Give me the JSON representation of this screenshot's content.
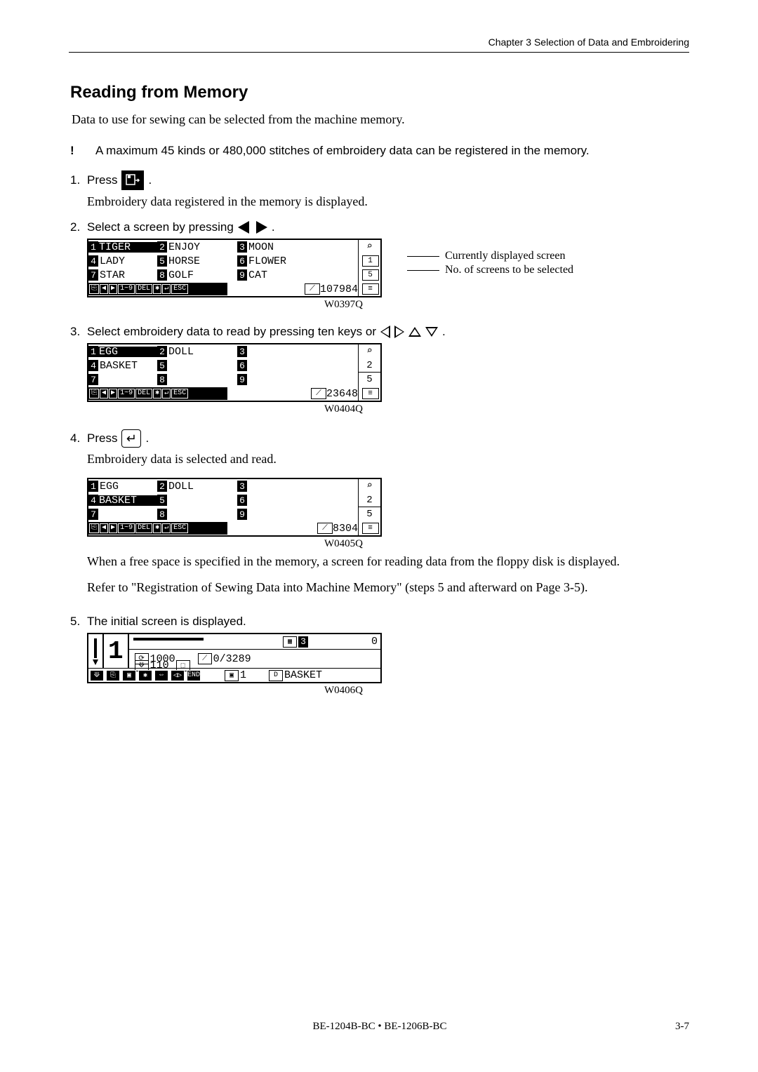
{
  "header": {
    "chapter": "Chapter 3   Selection of Data and Embroidering"
  },
  "section": {
    "title": "Reading from Memory",
    "intro": "Data to use for sewing can be selected from the machine memory.",
    "note_mark": "!",
    "note": "A maximum 45 kinds or 480,000 stitches of embroidery data can be registered in the memory."
  },
  "steps": {
    "s1": {
      "num": "1.",
      "label": "Press",
      "after": ".",
      "sub": "Embroidery data registered in the memory is displayed."
    },
    "s2": {
      "num": "2.",
      "label": "Select a screen by pressing",
      "after": ".",
      "lcd": {
        "r1": [
          "1",
          "TIGER",
          "2",
          "ENJOY",
          "3",
          "MOON"
        ],
        "r2": [
          "4",
          "LADY",
          "5",
          "HORSE",
          "6",
          "FLOWER"
        ],
        "r3": [
          "7",
          "STAR",
          "8",
          "GOLF",
          "9",
          "CAT"
        ],
        "stitches_label": "107984",
        "right": [
          "",
          "1",
          "5",
          ""
        ],
        "annot1": "Currently displayed screen",
        "annot2": "No. of screens to be selected"
      },
      "ref": "W0397Q"
    },
    "s3": {
      "num": "3.",
      "label": "Select embroidery data to read by pressing ten keys or",
      "after": ".",
      "lcd": {
        "r1": [
          "1",
          "EGG",
          "2",
          "DOLL",
          "3",
          ""
        ],
        "r2": [
          "4",
          "BASKET",
          "5",
          "",
          "6",
          ""
        ],
        "r3": [
          "7",
          "",
          "8",
          "",
          "9",
          ""
        ],
        "stitches_label": "23648",
        "right": [
          "",
          "2",
          "5",
          ""
        ]
      },
      "ref": "W0404Q"
    },
    "s4": {
      "num": "4.",
      "label": "Press",
      "after": ".",
      "sub": "Embroidery data is selected and read.",
      "lcd": {
        "r1": [
          "1",
          "EGG",
          "2",
          "DOLL",
          "3",
          ""
        ],
        "r2": [
          "4",
          "BASKET",
          "5",
          "",
          "6",
          ""
        ],
        "r3": [
          "7",
          "",
          "8",
          "",
          "9",
          ""
        ],
        "stitches_label": "8304",
        "right": [
          "",
          "2",
          "5",
          ""
        ]
      },
      "ref": "W0405Q",
      "para1": "When a free space is specified in the memory, a screen for reading data from the floppy disk is displayed.",
      "para2": "Refer to \"Registration of Sewing Data into Machine Memory\" (steps 5 and afterward on Page 3-5)."
    },
    "s5": {
      "num": "5.",
      "label": "The initial screen is displayed.",
      "lcd": {
        "big": "1",
        "v1": "1000",
        "v2": "110",
        "v3": "3",
        "v4": "0/3289",
        "v5": "1",
        "v6": "BASKET"
      },
      "ref": "W0406Q"
    }
  },
  "footer": {
    "center": "BE-1204B-BC • BE-1206B-BC",
    "right": "3-7"
  }
}
